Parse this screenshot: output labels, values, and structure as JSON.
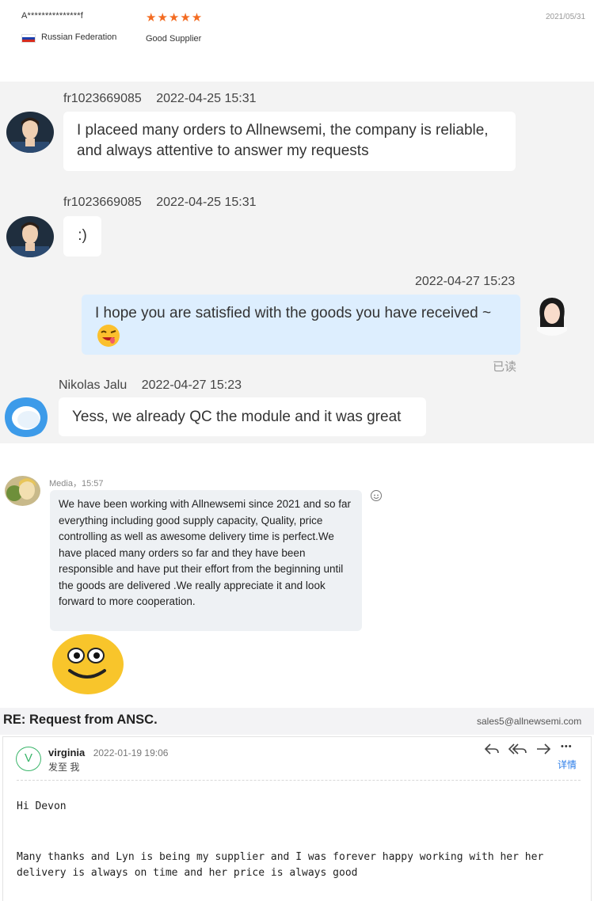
{
  "review": {
    "reviewer": "A***************f",
    "stars": "★★★★★",
    "date": "2021/05/31",
    "country": "Russian Federation",
    "tag": "Good Supplier"
  },
  "chat": {
    "messages": [
      {
        "sender": "fr1023669085",
        "time": "2022-04-25 15:31",
        "text": "I placeed many orders to Allnewsemi, the company is reliable, and always attentive to answer my requests"
      },
      {
        "sender": "fr1023669085",
        "time": "2022-04-25 15:31",
        "text": ":)"
      },
      {
        "time": "2022-04-27 15:23",
        "text": "I hope you are satisfied with the goods you have received ~",
        "read_status": "已读"
      },
      {
        "sender": "Nikolas Jalu",
        "time": "2022-04-27 15:23",
        "text": "Yess, we already QC the module and it was great"
      }
    ]
  },
  "media_chat": {
    "meta": "Media，15:57",
    "text": "We have been working with Allnewsemi since 2021 and so far everything including  good supply capacity, Quality, price controlling as well as awesome delivery time  is perfect.We have placed many orders so far and they have been responsible and have put their effort from the beginning until the goods are delivered .We really appreciate it and look forward to more cooperation."
  },
  "email": {
    "subject": "RE: Request from ANSC.",
    "address": "sales5@allnewsemi.com",
    "sender_initial": "V",
    "sender": "virginia",
    "date": "2022-01-19 19:06",
    "to": "发至 我",
    "details": "详情",
    "more": "•••",
    "greeting": "Hi Devon",
    "body": "Many thanks and Lyn is being my supplier and I was forever happy working with her her delivery is always on time and her price is always good"
  },
  "icons": [
    "star-icon",
    "flag-icon",
    "smiley-icon",
    "reply-icon",
    "reply-all-icon",
    "forward-icon",
    "more-icon",
    "emoji-wink-icon",
    "emoji-smile-icon"
  ],
  "colors": {
    "star": "#f36b21",
    "chat_bg": "#f3f3f3",
    "my_bubble": "#ddeefe",
    "link": "#2b7de9",
    "avatar_ring": "#3ab56a"
  }
}
